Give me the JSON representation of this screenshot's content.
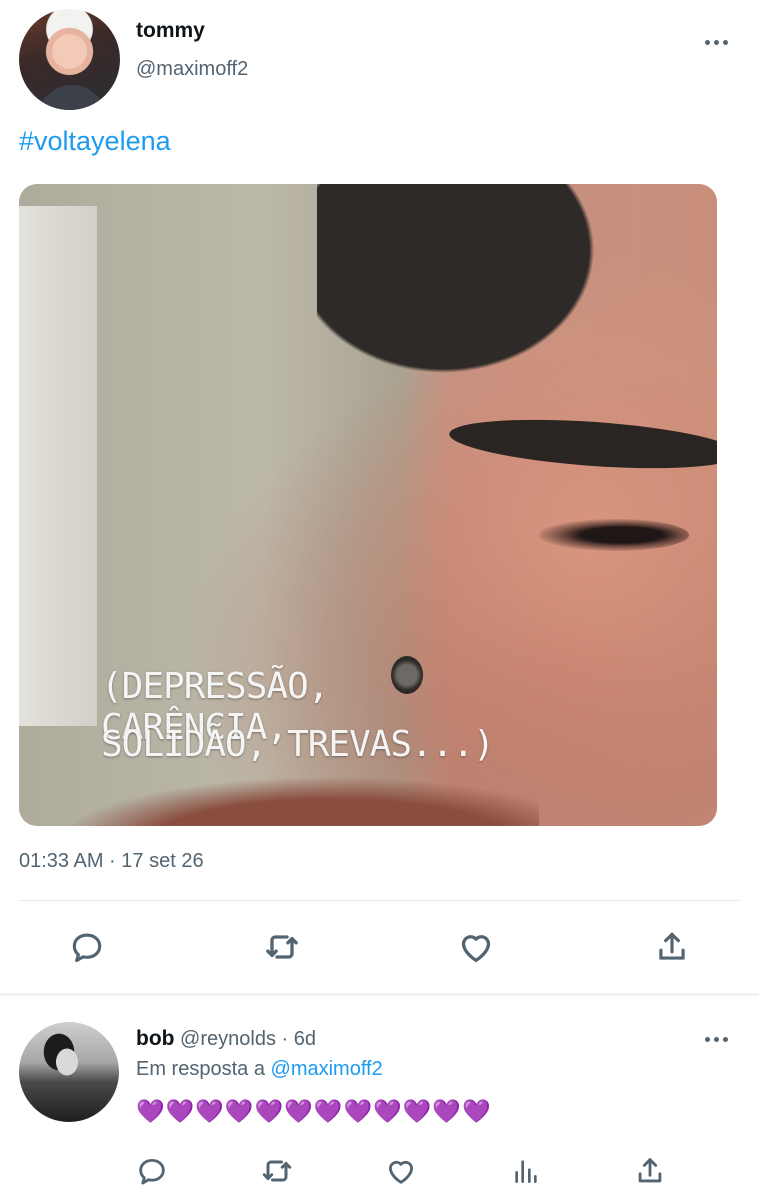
{
  "tweet": {
    "author_name": "tommy",
    "author_handle": "@maximoff2",
    "text": "#voltayelena",
    "media_caption_line1": "(DEPRESSÃO, CARÊNCIA,",
    "media_caption_line2": "SOLIDÃO, TREVAS...)",
    "timestamp": "01:33 AM · 17 set 26",
    "actions": [
      "reply-icon",
      "retweet-icon",
      "like-icon",
      "share-icon"
    ]
  },
  "reply": {
    "author_name": "bob",
    "author_handle": "@reynolds",
    "age": "· 6d",
    "replying_to_prefix": "Em resposta a",
    "replying_to_handle": "@maximoff2",
    "text": "💜💜💜💜💜💜💜💜💜💜💜💜",
    "actions": [
      "reply-icon",
      "retweet-icon",
      "like-icon",
      "analytics-icon",
      "share-icon"
    ]
  },
  "colors": {
    "accent": "#1d9bf0",
    "secondary_text": "#536471",
    "heart_purple": "#a855f7"
  }
}
